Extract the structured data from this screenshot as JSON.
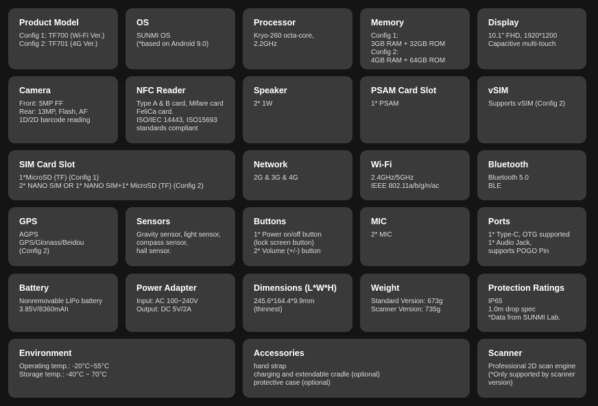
{
  "cards": [
    {
      "title": "Product Model",
      "lines": [
        "Config 1: TF700 (Wi-Fi Ver.)",
        "Config 2: TF701 (4G Ver.)"
      ]
    },
    {
      "title": "OS",
      "lines": [
        "SUNMI OS",
        "(*based on Android 9.0)"
      ]
    },
    {
      "title": "Processor",
      "lines": [
        "Kryo-260 octa-core,",
        "2.2GHz"
      ]
    },
    {
      "title": "Memory",
      "lines": [
        "Config 1:",
        "3GB RAM + 32GB ROM",
        "Config 2:",
        "4GB RAM + 64GB ROM"
      ]
    },
    {
      "title": "Display",
      "lines": [
        "10.1\" FHD, 1920*1200",
        "Capacitive multi-touch"
      ]
    },
    {
      "title": "Camera",
      "lines": [
        "Front: 5MP FF",
        "Rear: 13MP, Flash, AF",
        "1D/2D barcode reading"
      ]
    },
    {
      "title": "NFC Reader",
      "lines": [
        "Type A & B card, Mifare card",
        "FeliCa card.",
        "ISO/IEC 14443, ISO15693",
        "standards compliant"
      ]
    },
    {
      "title": "Speaker",
      "lines": [
        "2* 1W"
      ]
    },
    {
      "title": "PSAM Card Slot",
      "lines": [
        "1* PSAM"
      ]
    },
    {
      "title": "vSIM",
      "lines": [
        "Supports vSIM (Config 2)"
      ]
    },
    {
      "title": "SIM Card Slot",
      "lines": [
        "1*MicroSD (TF) (Config 1)",
        "2* NANO SIM OR 1* NANO SIM+1* MicroSD (TF) (Config 2)"
      ]
    },
    {
      "title": "Network",
      "lines": [
        "2G & 3G & 4G"
      ]
    },
    {
      "title": "Wi-Fi",
      "lines": [
        "2.4GHz/5GHz",
        "IEEE 802.11a/b/g/n/ac"
      ]
    },
    {
      "title": "Bluetooth",
      "lines": [
        "Bluetooth 5.0",
        "BLE"
      ]
    },
    {
      "title": "GPS",
      "lines": [
        "AGPS",
        "GPS/Glonass/Beidou",
        " (Config 2)"
      ]
    },
    {
      "title": "Sensors",
      "lines": [
        "Gravity sensor, light sensor,",
        "compass sensor,",
        "hall sensor."
      ]
    },
    {
      "title": "Buttons",
      "lines": [
        "1* Power on/off button",
        "(lock screen button)",
        "2* Volume (+/-) button"
      ]
    },
    {
      "title": "MIC",
      "lines": [
        "2* MIC"
      ]
    },
    {
      "title": "Ports",
      "lines": [
        "1* Type-C, OTG supported",
        "1* Audio Jack,",
        "supports POGO Pin"
      ]
    },
    {
      "title": "Battery",
      "lines": [
        "Nonremovable LiPo battery",
        "3.85V/8360mAh"
      ]
    },
    {
      "title": "Power Adapter",
      "lines": [
        "Input: AC 100~240V",
        "Output: DC 5V/2A"
      ]
    },
    {
      "title": "Dimensions (L*W*H)",
      "lines": [
        "245.6*164.4*9.9mm",
        "(thinnest)"
      ]
    },
    {
      "title": "Weight",
      "lines": [
        "Standard Version: 673g",
        "Scanner Version: 735g"
      ]
    },
    {
      "title": "Protection Ratings",
      "lines": [
        "IP65",
        "1.0m drop spec",
        "*Data from SUNMI Lab."
      ]
    },
    {
      "title": "Environment",
      "lines": [
        "Operating temp.: -20°C~55°C",
        "Storage temp.: -40°C ~ 70°C"
      ]
    },
    {
      "title": "Accessories",
      "lines": [
        "hand strap",
        "charging and extendable cradle (optional)",
        "protective case (optional)"
      ]
    },
    {
      "title": "Scanner",
      "lines": [
        "Professional 2D scan engine",
        "(*Only supported by scanner",
        "version)"
      ]
    }
  ]
}
